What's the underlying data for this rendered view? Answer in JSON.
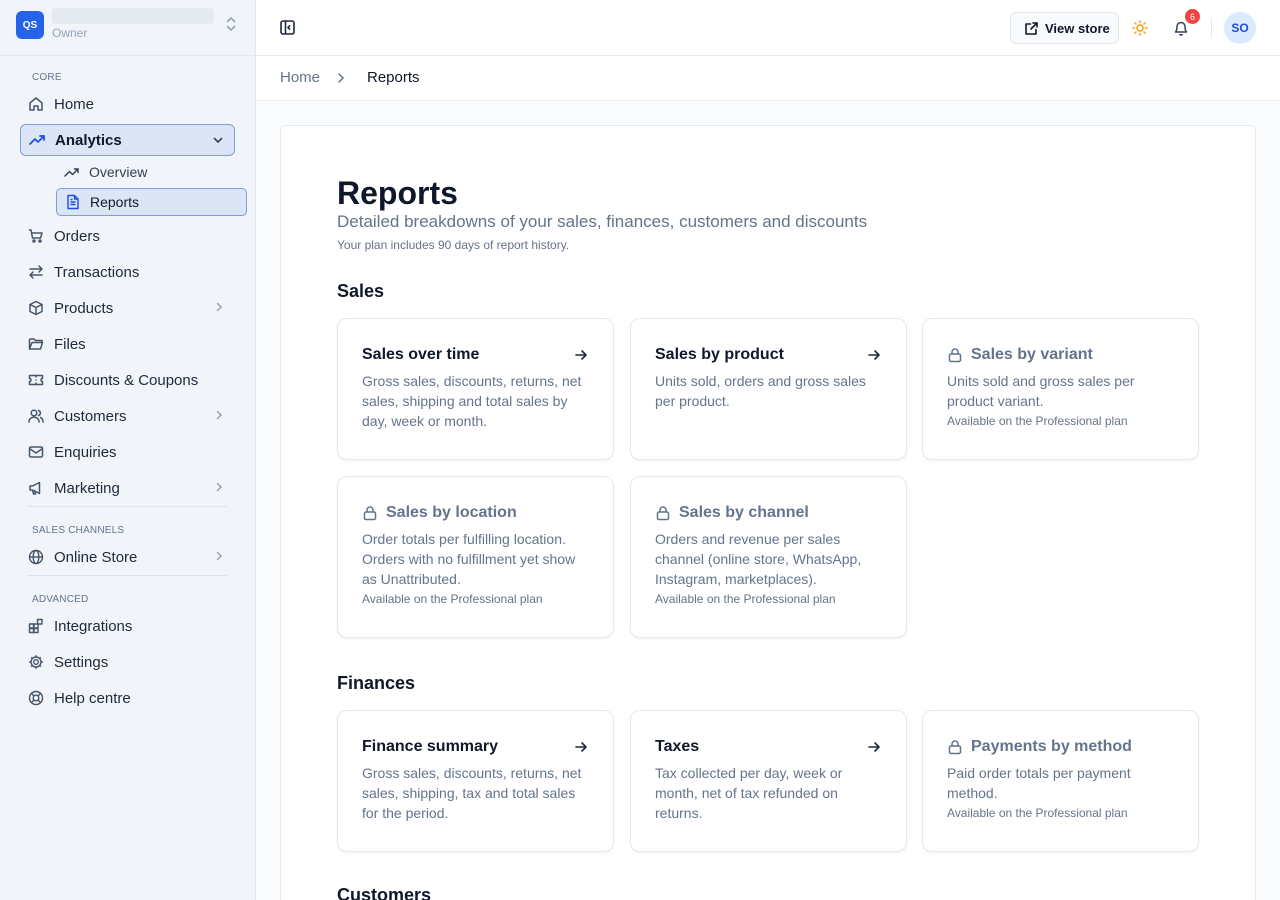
{
  "store": {
    "logo_text": "QS",
    "role": "Owner"
  },
  "sidebar": {
    "sections": {
      "core": "CORE",
      "sales_channels": "SALES CHANNELS",
      "advanced": "ADVANCED"
    },
    "items": {
      "home": "Home",
      "analytics": "Analytics",
      "overview": "Overview",
      "reports": "Reports",
      "orders": "Orders",
      "transactions": "Transactions",
      "products": "Products",
      "files": "Files",
      "discounts": "Discounts & Coupons",
      "customers": "Customers",
      "enquiries": "Enquiries",
      "marketing": "Marketing",
      "online_store": "Online Store",
      "integrations": "Integrations",
      "settings": "Settings",
      "help": "Help centre"
    }
  },
  "header": {
    "view_store": "View store",
    "notifications_count": "6",
    "avatar_initials": "SO"
  },
  "breadcrumb": {
    "home": "Home",
    "current": "Reports"
  },
  "page": {
    "title": "Reports",
    "subtitle": "Detailed breakdowns of your sales, finances, customers and discounts",
    "note": "Your plan includes 90 days of report history."
  },
  "sections": {
    "sales": {
      "title": "Sales",
      "cards": [
        {
          "title": "Sales over time",
          "desc": "Gross sales, discounts, returns, net sales, shipping and total sales by day, week or month."
        },
        {
          "title": "Sales by product",
          "desc": "Units sold, orders and gross sales per product."
        },
        {
          "title": "Sales by variant",
          "desc": "Units sold and gross sales per product variant.",
          "plan": "Available on the Professional plan"
        },
        {
          "title": "Sales by location",
          "desc": "Order totals per fulfilling location. Orders with no fulfillment yet show as Unattributed.",
          "plan": "Available on the Professional plan"
        },
        {
          "title": "Sales by channel",
          "desc": "Orders and revenue per sales channel (online store, WhatsApp, Instagram, marketplaces).",
          "plan": "Available on the Professional plan"
        }
      ]
    },
    "finances": {
      "title": "Finances",
      "cards": [
        {
          "title": "Finance summary",
          "desc": "Gross sales, discounts, returns, net sales, shipping, tax and total sales for the period."
        },
        {
          "title": "Taxes",
          "desc": "Tax collected per day, week or month, net of tax refunded on returns."
        },
        {
          "title": "Payments by method",
          "desc": "Paid order totals per payment method.",
          "plan": "Available on the Professional plan"
        }
      ]
    },
    "customers": {
      "title": "Customers"
    }
  },
  "icons": {
    "arrow": "arrow-right-icon",
    "lock": "lock-icon"
  },
  "colors": {
    "accent": "#2563eb",
    "badge": "#ef4444",
    "sun": "#f59e0b"
  }
}
